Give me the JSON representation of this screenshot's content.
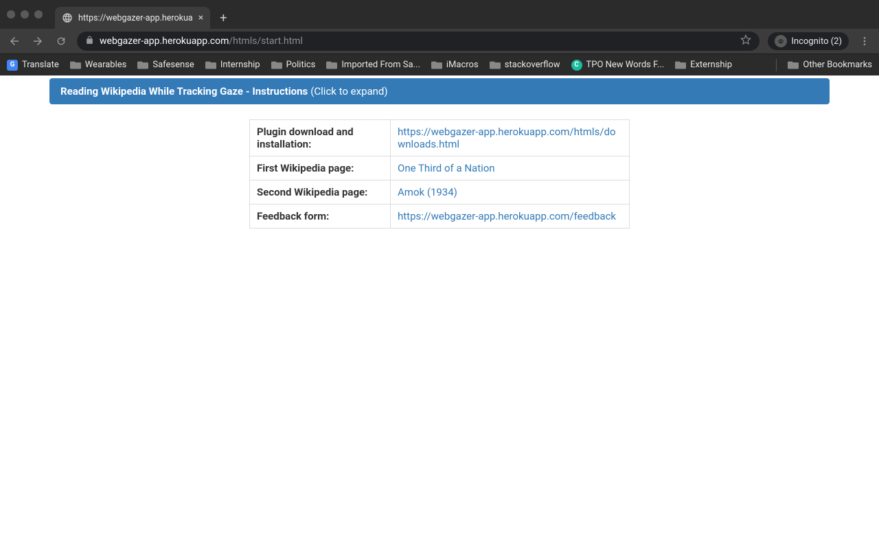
{
  "browser": {
    "tab_title": "https://webgazer-app.herokua",
    "url_domain": "webgazer-app.herokuapp.com",
    "url_path": "/htmls/start.html",
    "incognito_label": "Incognito (2)"
  },
  "bookmarks": {
    "items": [
      {
        "label": "Translate",
        "icon": "translate"
      },
      {
        "label": "Wearables",
        "icon": "folder"
      },
      {
        "label": "Safesense",
        "icon": "folder"
      },
      {
        "label": "Internship",
        "icon": "folder"
      },
      {
        "label": "Politics",
        "icon": "folder"
      },
      {
        "label": "Imported From Sa...",
        "icon": "folder"
      },
      {
        "label": "iMacros",
        "icon": "folder"
      },
      {
        "label": "stackoverflow",
        "icon": "folder"
      },
      {
        "label": "TPO New Words F...",
        "icon": "tpo"
      },
      {
        "label": "Externship",
        "icon": "folder"
      }
    ],
    "other_label": "Other Bookmarks"
  },
  "banner": {
    "title": "Reading Wikipedia While Tracking Gaze - Instructions",
    "suffix": "(Click to expand)"
  },
  "table": {
    "rows": [
      {
        "label": "Plugin download and installation:",
        "link": "https://webgazer-app.herokuapp.com/htmls/downloads.html"
      },
      {
        "label": "First Wikipedia page:",
        "link": "One Third of a Nation"
      },
      {
        "label": "Second Wikipedia page:",
        "link": "Amok (1934)"
      },
      {
        "label": "Feedback form:",
        "link": "https://webgazer-app.herokuapp.com/feedback"
      }
    ]
  }
}
